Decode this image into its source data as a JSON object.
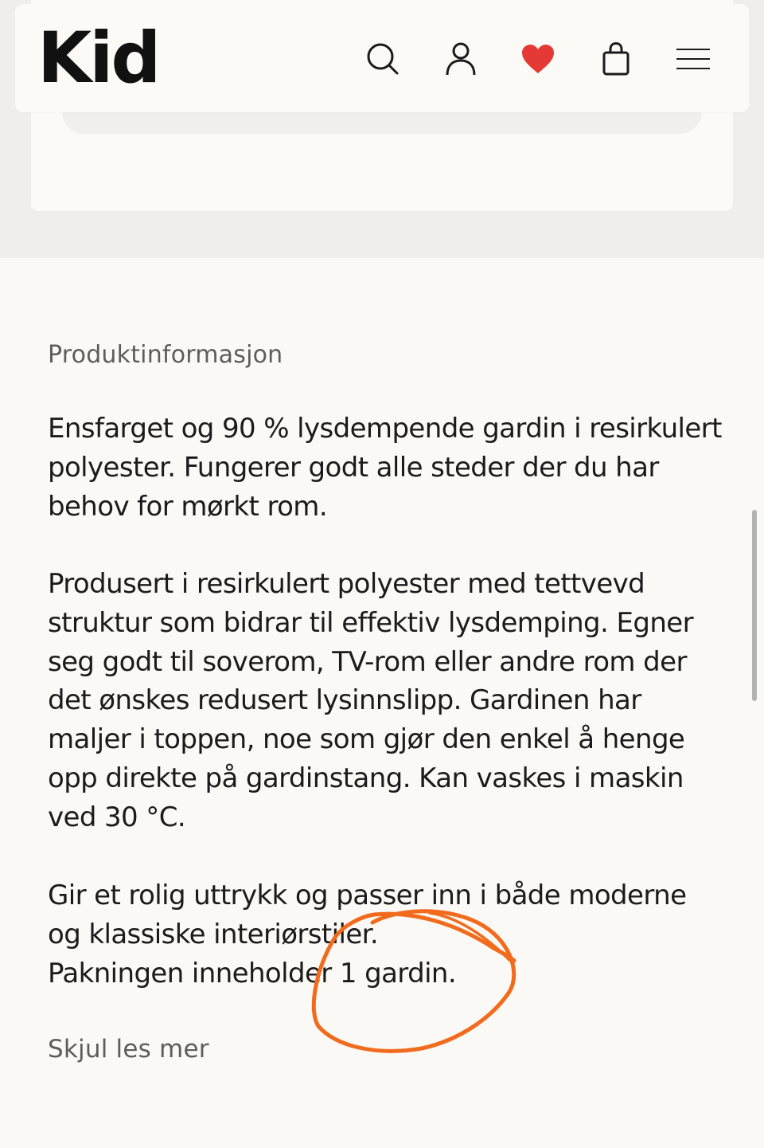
{
  "header": {
    "logo": "Kid",
    "icons": [
      "search-icon",
      "user-icon",
      "heart-icon",
      "bag-icon",
      "menu-icon"
    ],
    "heart_color": "#e53935"
  },
  "product_info": {
    "title": "Produktinformasjon",
    "paragraph1": [
      "Ensfarget og 90 % lysdempende gardin i resirkulert",
      "polyester. Fungerer godt alle steder der du har",
      "behov for mørkt rom."
    ],
    "paragraph2": [
      "Produsert i resirkulert polyester med tettvevd",
      "struktur som bidrar til effektiv lysdemping. Egner",
      "seg godt til soverom, TV-rom eller andre rom der",
      "det ønskes redusert lysinnslipp. Gardinen har",
      "maljer i toppen, noe som gjør den enkel å henge",
      "opp direkte på gardinstang. Kan vaskes i maskin",
      "ved 30 °C."
    ],
    "paragraph3": [
      "Gir et rolig uttrykk og passer inn i både moderne",
      "og klassiske interiørstiler.",
      "Pakningen inneholder 1 gardin."
    ],
    "read_less": "Skjul les mer"
  },
  "annotation_color": "#f26b1d"
}
